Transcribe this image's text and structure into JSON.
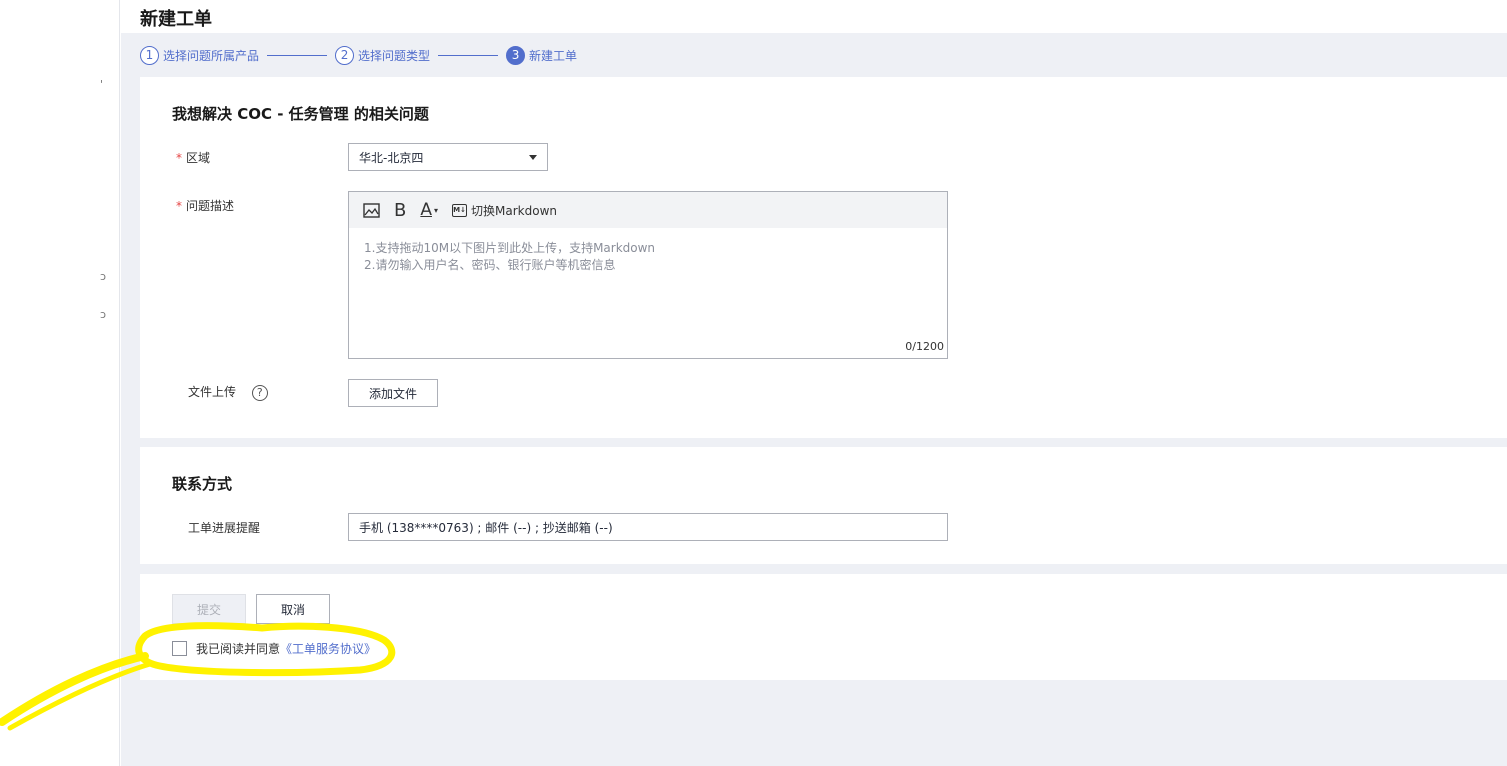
{
  "page": {
    "title": "新建工单"
  },
  "rail": {
    "marks": [
      "'",
      "ɔ",
      "ɔ"
    ]
  },
  "steps": [
    {
      "num": "1",
      "label": "选择问题所属产品",
      "state": "done"
    },
    {
      "num": "2",
      "label": "选择问题类型",
      "state": "done"
    },
    {
      "num": "3",
      "label": "新建工单",
      "state": "active"
    }
  ],
  "problem_section": {
    "title": "我想解决 COC - 任务管理 的相关问题",
    "region": {
      "label": "区域",
      "required_mark": "*",
      "value": "华北-北京四"
    },
    "description": {
      "label": "问题描述",
      "required_mark": "*",
      "toolbar": {
        "image_icon": "image-icon",
        "bold_label": "B",
        "font_color_label": "A",
        "font_color_caret": "▾",
        "markdown_badge": "M↓",
        "markdown_label": "切换Markdown"
      },
      "placeholder_line1": "1.支持拖动10M以下图片到此处上传，支持Markdown",
      "placeholder_line2": "2.请勿输入用户名、密码、银行账户等机密信息",
      "char_count": "0/1200"
    },
    "upload": {
      "label": "文件上传",
      "help_icon": "?",
      "button_label": "添加文件"
    }
  },
  "contact_section": {
    "title": "联系方式",
    "progress_label": "工单进展提醒",
    "progress_value": "手机 (138****0763) ; 邮件 (--) ; 抄送邮箱 (--)"
  },
  "actions": {
    "submit_label": "提交",
    "cancel_label": "取消",
    "agree_text": "我已阅读并同意",
    "agree_link": "《工单服务协议》"
  },
  "colors": {
    "accent": "#526ecc",
    "highlight": "#fff200",
    "required": "#e54545"
  }
}
